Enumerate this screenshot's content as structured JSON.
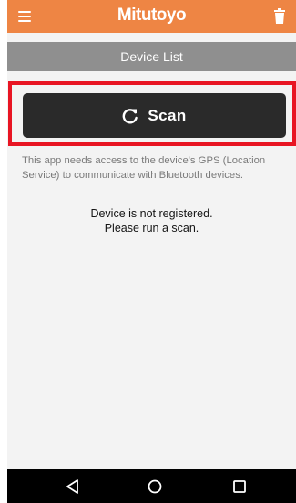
{
  "app_bar": {
    "brand": "Mitutoyo",
    "color": "#ee8544",
    "menu_icon": "hamburger-menu-icon",
    "delete_icon": "trash-icon"
  },
  "sub_header": {
    "title": "Device List",
    "color": "#8f8f8f"
  },
  "scan_button": {
    "label": "Scan",
    "icon": "refresh-icon",
    "color": "#2a2a2a"
  },
  "highlight_color": "#e81523",
  "notice": "This app needs access to the device's GPS (Location Service) to communicate with Bluetooth devices.",
  "status": {
    "line1": "Device is not registered.",
    "line2": "Please run a scan."
  },
  "nav_bar": {
    "back_icon": "triangle-back-icon",
    "home_icon": "circle-home-icon",
    "recent_icon": "square-recents-icon"
  }
}
